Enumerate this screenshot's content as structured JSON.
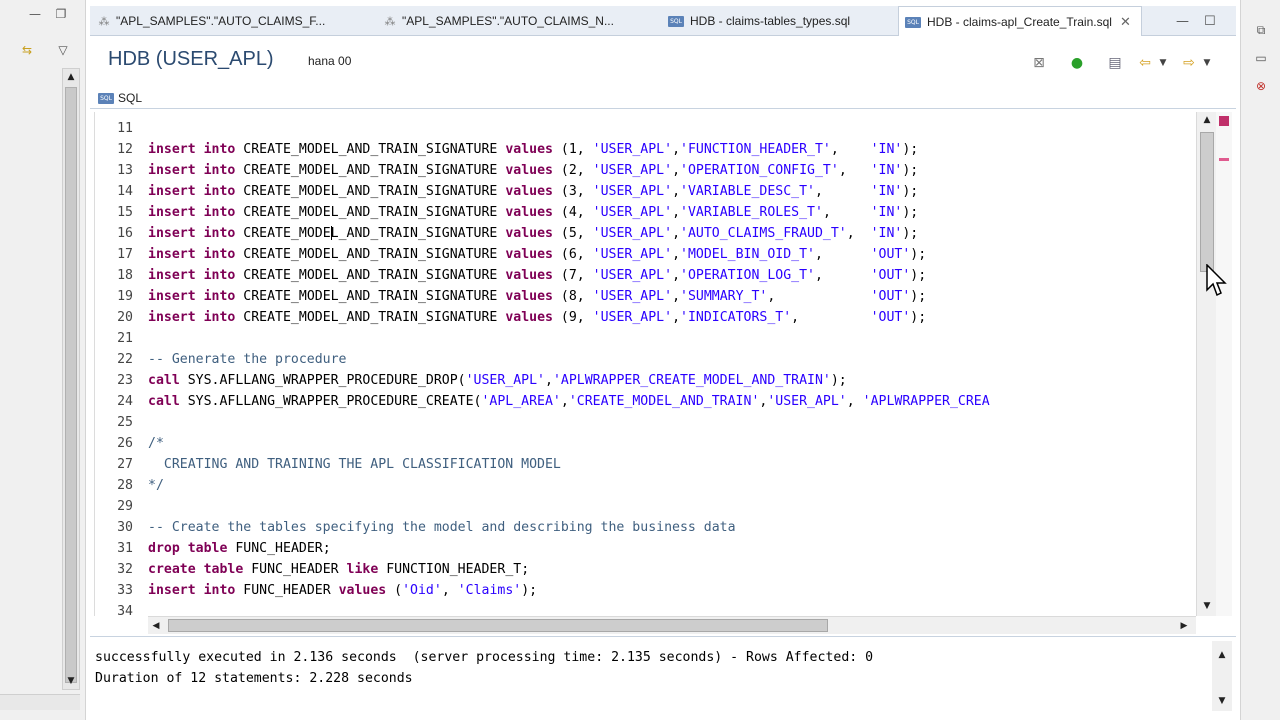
{
  "left_panel": {
    "minimize_icon": "minimize-icon",
    "maximize_icon": "maximize-icon",
    "sync_icon": "link-sync-icon",
    "menu_icon": "chevron-down-icon"
  },
  "tabs": [
    {
      "label": "\"APL_SAMPLES\".\"AUTO_CLAIMS_F...",
      "icon": "table-icon",
      "active": false
    },
    {
      "label": "\"APL_SAMPLES\".\"AUTO_CLAIMS_N...",
      "icon": "table-icon",
      "active": false
    },
    {
      "label": "HDB - claims-tables_types.sql",
      "icon": "sql-file-icon",
      "active": false
    },
    {
      "label": "HDB - claims-apl_Create_Train.sql",
      "icon": "sql-file-icon",
      "active": true
    }
  ],
  "sql_icon_text": "SQL",
  "header": {
    "title": "HDB (USER_APL)",
    "subtitle": "hana 00",
    "tools": [
      "stop-icon",
      "execute-icon",
      "explain-icon",
      "back-icon",
      "dropdown-icon",
      "forward-icon",
      "dropdown-icon"
    ]
  },
  "editor": {
    "subtab_label": "SQL",
    "lines": [
      {
        "n": "11",
        "parts": []
      },
      {
        "n": "12",
        "parts": [
          {
            "t": "insert",
            "c": "kw"
          },
          {
            "t": " "
          },
          {
            "t": "into",
            "c": "kw"
          },
          {
            "t": " CREATE_MODEL_AND_TRAIN_SIGNATURE "
          },
          {
            "t": "values",
            "c": "kw"
          },
          {
            "t": " (1, "
          },
          {
            "t": "'USER_APL'",
            "c": "st"
          },
          {
            "t": ","
          },
          {
            "t": "'FUNCTION_HEADER_T'",
            "c": "st"
          },
          {
            "t": ",    "
          },
          {
            "t": "'IN'",
            "c": "st"
          },
          {
            "t": ");"
          }
        ]
      },
      {
        "n": "13",
        "parts": [
          {
            "t": "insert",
            "c": "kw"
          },
          {
            "t": " "
          },
          {
            "t": "into",
            "c": "kw"
          },
          {
            "t": " CREATE_MODEL_AND_TRAIN_SIGNATURE "
          },
          {
            "t": "values",
            "c": "kw"
          },
          {
            "t": " (2, "
          },
          {
            "t": "'USER_APL'",
            "c": "st"
          },
          {
            "t": ","
          },
          {
            "t": "'OPERATION_CONFIG_T'",
            "c": "st"
          },
          {
            "t": ",   "
          },
          {
            "t": "'IN'",
            "c": "st"
          },
          {
            "t": ");"
          }
        ]
      },
      {
        "n": "14",
        "parts": [
          {
            "t": "insert",
            "c": "kw"
          },
          {
            "t": " "
          },
          {
            "t": "into",
            "c": "kw"
          },
          {
            "t": " CREATE_MODEL_AND_TRAIN_SIGNATURE "
          },
          {
            "t": "values",
            "c": "kw"
          },
          {
            "t": " (3, "
          },
          {
            "t": "'USER_APL'",
            "c": "st"
          },
          {
            "t": ","
          },
          {
            "t": "'VARIABLE_DESC_T'",
            "c": "st"
          },
          {
            "t": ",      "
          },
          {
            "t": "'IN'",
            "c": "st"
          },
          {
            "t": ");"
          }
        ]
      },
      {
        "n": "15",
        "parts": [
          {
            "t": "insert",
            "c": "kw"
          },
          {
            "t": " "
          },
          {
            "t": "into",
            "c": "kw"
          },
          {
            "t": " CREATE_MODEL_AND_TRAIN_SIGNATURE "
          },
          {
            "t": "values",
            "c": "kw"
          },
          {
            "t": " (4, "
          },
          {
            "t": "'USER_APL'",
            "c": "st"
          },
          {
            "t": ","
          },
          {
            "t": "'VARIABLE_ROLES_T'",
            "c": "st"
          },
          {
            "t": ",     "
          },
          {
            "t": "'IN'",
            "c": "st"
          },
          {
            "t": ");"
          }
        ]
      },
      {
        "n": "16",
        "parts": [
          {
            "t": "insert",
            "c": "kw"
          },
          {
            "t": " "
          },
          {
            "t": "into",
            "c": "kw"
          },
          {
            "t": " CREATE_MODE"
          },
          {
            "t": "",
            "c": "caret"
          },
          {
            "t": "L_AND_TRAIN_SIGNATURE "
          },
          {
            "t": "values",
            "c": "kw"
          },
          {
            "t": " (5, "
          },
          {
            "t": "'USER_APL'",
            "c": "st"
          },
          {
            "t": ","
          },
          {
            "t": "'AUTO_CLAIMS_FRAUD_T'",
            "c": "st"
          },
          {
            "t": ",  "
          },
          {
            "t": "'IN'",
            "c": "st"
          },
          {
            "t": ");"
          }
        ]
      },
      {
        "n": "17",
        "parts": [
          {
            "t": "insert",
            "c": "kw"
          },
          {
            "t": " "
          },
          {
            "t": "into",
            "c": "kw"
          },
          {
            "t": " CREATE_MODEL_AND_TRAIN_SIGNATURE "
          },
          {
            "t": "values",
            "c": "kw"
          },
          {
            "t": " (6, "
          },
          {
            "t": "'USER_APL'",
            "c": "st"
          },
          {
            "t": ","
          },
          {
            "t": "'MODEL_BIN_OID_T'",
            "c": "st"
          },
          {
            "t": ",      "
          },
          {
            "t": "'OUT'",
            "c": "st"
          },
          {
            "t": ");"
          }
        ]
      },
      {
        "n": "18",
        "parts": [
          {
            "t": "insert",
            "c": "kw"
          },
          {
            "t": " "
          },
          {
            "t": "into",
            "c": "kw"
          },
          {
            "t": " CREATE_MODEL_AND_TRAIN_SIGNATURE "
          },
          {
            "t": "values",
            "c": "kw"
          },
          {
            "t": " (7, "
          },
          {
            "t": "'USER_APL'",
            "c": "st"
          },
          {
            "t": ","
          },
          {
            "t": "'OPERATION_LOG_T'",
            "c": "st"
          },
          {
            "t": ",      "
          },
          {
            "t": "'OUT'",
            "c": "st"
          },
          {
            "t": ");"
          }
        ]
      },
      {
        "n": "19",
        "parts": [
          {
            "t": "insert",
            "c": "kw"
          },
          {
            "t": " "
          },
          {
            "t": "into",
            "c": "kw"
          },
          {
            "t": " CREATE_MODEL_AND_TRAIN_SIGNATURE "
          },
          {
            "t": "values",
            "c": "kw"
          },
          {
            "t": " (8, "
          },
          {
            "t": "'USER_APL'",
            "c": "st"
          },
          {
            "t": ","
          },
          {
            "t": "'SUMMARY_T'",
            "c": "st"
          },
          {
            "t": ",            "
          },
          {
            "t": "'OUT'",
            "c": "st"
          },
          {
            "t": ");"
          }
        ]
      },
      {
        "n": "20",
        "parts": [
          {
            "t": "insert",
            "c": "kw"
          },
          {
            "t": " "
          },
          {
            "t": "into",
            "c": "kw"
          },
          {
            "t": " CREATE_MODEL_AND_TRAIN_SIGNATURE "
          },
          {
            "t": "values",
            "c": "kw"
          },
          {
            "t": " (9, "
          },
          {
            "t": "'USER_APL'",
            "c": "st"
          },
          {
            "t": ","
          },
          {
            "t": "'INDICATORS_T'",
            "c": "st"
          },
          {
            "t": ",         "
          },
          {
            "t": "'OUT'",
            "c": "st"
          },
          {
            "t": ");"
          }
        ]
      },
      {
        "n": "21",
        "parts": []
      },
      {
        "n": "22",
        "parts": [
          {
            "t": "-- Generate the procedure",
            "c": "cm"
          }
        ]
      },
      {
        "n": "23",
        "parts": [
          {
            "t": "call",
            "c": "kw"
          },
          {
            "t": " SYS.AFLLANG_WRAPPER_PROCEDURE_DROP("
          },
          {
            "t": "'USER_APL'",
            "c": "st"
          },
          {
            "t": ","
          },
          {
            "t": "'APLWRAPPER_CREATE_MODEL_AND_TRAIN'",
            "c": "st"
          },
          {
            "t": ");"
          }
        ]
      },
      {
        "n": "24",
        "parts": [
          {
            "t": "call",
            "c": "kw"
          },
          {
            "t": " SYS.AFLLANG_WRAPPER_PROCEDURE_CREATE("
          },
          {
            "t": "'APL_AREA'",
            "c": "st"
          },
          {
            "t": ","
          },
          {
            "t": "'CREATE_MODEL_AND_TRAIN'",
            "c": "st"
          },
          {
            "t": ","
          },
          {
            "t": "'USER_APL'",
            "c": "st"
          },
          {
            "t": ", "
          },
          {
            "t": "'APLWRAPPER_CREA",
            "c": "st"
          }
        ]
      },
      {
        "n": "25",
        "parts": []
      },
      {
        "n": "26",
        "parts": [
          {
            "t": "/*",
            "c": "cm"
          }
        ]
      },
      {
        "n": "27",
        "parts": [
          {
            "t": "  CREATING AND TRAINING THE APL CLASSIFICATION MODEL",
            "c": "cm"
          }
        ]
      },
      {
        "n": "28",
        "parts": [
          {
            "t": "*/",
            "c": "cm"
          }
        ]
      },
      {
        "n": "29",
        "parts": []
      },
      {
        "n": "30",
        "parts": [
          {
            "t": "-- Create the tables specifying the model and describing the business data",
            "c": "cm"
          }
        ]
      },
      {
        "n": "31",
        "parts": [
          {
            "t": "drop",
            "c": "kw"
          },
          {
            "t": " "
          },
          {
            "t": "table",
            "c": "kw"
          },
          {
            "t": " FUNC_HEADER;"
          }
        ]
      },
      {
        "n": "32",
        "parts": [
          {
            "t": "create",
            "c": "kw"
          },
          {
            "t": " "
          },
          {
            "t": "table",
            "c": "kw"
          },
          {
            "t": " FUNC_HEADER "
          },
          {
            "t": "like",
            "c": "kw"
          },
          {
            "t": " FUNCTION_HEADER_T;"
          }
        ]
      },
      {
        "n": "33",
        "parts": [
          {
            "t": "insert",
            "c": "kw"
          },
          {
            "t": " "
          },
          {
            "t": "into",
            "c": "kw"
          },
          {
            "t": " FUNC_HEADER "
          },
          {
            "t": "values",
            "c": "kw"
          },
          {
            "t": " ("
          },
          {
            "t": "'Oid'",
            "c": "st"
          },
          {
            "t": ", "
          },
          {
            "t": "'Claims'",
            "c": "st"
          },
          {
            "t": ");"
          }
        ]
      },
      {
        "n": "34",
        "parts": []
      }
    ]
  },
  "console": {
    "lines": [
      "successfully executed in 2.136 seconds  (server processing time: 2.135 seconds) - Rows Affected: 0",
      "Duration of 12 statements: 2.228 seconds"
    ]
  },
  "colors": {
    "keyword": "#7f0055",
    "string": "#2a00ff",
    "comment": "#3f5f7f",
    "header_title": "#2b4a70"
  }
}
